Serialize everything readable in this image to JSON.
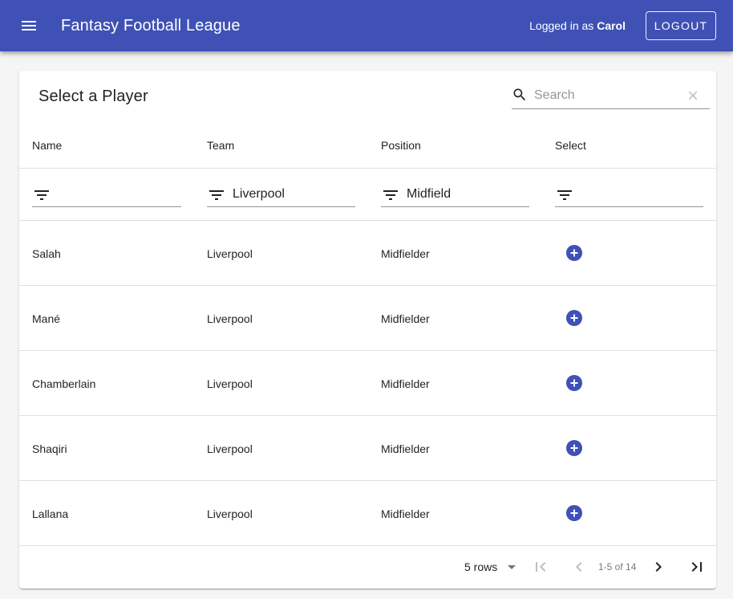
{
  "appbar": {
    "title": "Fantasy Football League",
    "logged_in_prefix": "Logged in as",
    "user_name": "Carol",
    "logout_label": "LOGOUT",
    "color": "#3f51b5"
  },
  "card": {
    "title": "Select a Player",
    "search": {
      "placeholder": "Search",
      "value": ""
    }
  },
  "table": {
    "columns": [
      "Name",
      "Team",
      "Position",
      "Select"
    ],
    "filters": [
      "",
      "Liverpool",
      "Midfield",
      ""
    ],
    "rows": [
      {
        "name": "Salah",
        "team": "Liverpool",
        "position": "Midfielder"
      },
      {
        "name": "Mané",
        "team": "Liverpool",
        "position": "Midfielder"
      },
      {
        "name": "Chamberlain",
        "team": "Liverpool",
        "position": "Midfielder"
      },
      {
        "name": "Shaqiri",
        "team": "Liverpool",
        "position": "Midfielder"
      },
      {
        "name": "Lallana",
        "team": "Liverpool",
        "position": "Midfielder"
      }
    ],
    "select_icon": "add-circle-icon",
    "select_color": "#3f51b5"
  },
  "pagination": {
    "rows_per_page": "5 rows",
    "range": "1-5 of 14"
  }
}
